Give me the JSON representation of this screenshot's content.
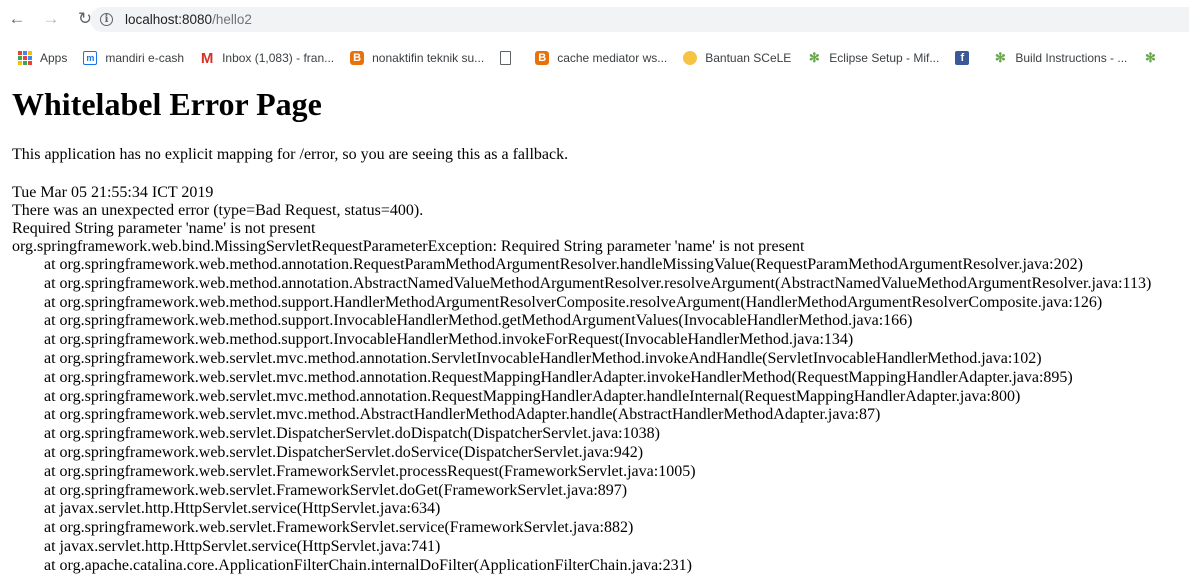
{
  "browser": {
    "url_host": "localhost:8080",
    "url_path": "/hello2",
    "bookmarks": [
      {
        "label": "Apps",
        "icon": "apps-grid-icon"
      },
      {
        "label": "mandiri e-cash",
        "icon": "mandiri-icon"
      },
      {
        "label": "Inbox (1,083) - fran...",
        "icon": "gmail-icon"
      },
      {
        "label": "nonaktifin teknik su...",
        "icon": "blogger-icon"
      },
      {
        "label": "",
        "icon": "document-icon"
      },
      {
        "label": "cache mediator ws...",
        "icon": "blogger-icon"
      },
      {
        "label": "Bantuan SCeLE",
        "icon": "scele-icon"
      },
      {
        "label": "Eclipse Setup - Mif...",
        "icon": "eclipse-icon"
      },
      {
        "label": "",
        "icon": "facebook-icon"
      },
      {
        "label": "Build Instructions - ...",
        "icon": "eclipse-icon"
      }
    ]
  },
  "page": {
    "title": "Whitelabel Error Page",
    "fallback": "This application has no explicit mapping for /error, so you are seeing this as a fallback.",
    "timestamp": "Tue Mar 05 21:55:34 ICT 2019",
    "error_line": "There was an unexpected error (type=Bad Request, status=400).",
    "message": "Required String parameter 'name' is not present",
    "exception": "org.springframework.web.bind.MissingServletRequestParameterException: Required String parameter 'name' is not present",
    "stack": [
      "at org.springframework.web.method.annotation.RequestParamMethodArgumentResolver.handleMissingValue(RequestParamMethodArgumentResolver.java:202)",
      "at org.springframework.web.method.annotation.AbstractNamedValueMethodArgumentResolver.resolveArgument(AbstractNamedValueMethodArgumentResolver.java:113)",
      "at org.springframework.web.method.support.HandlerMethodArgumentResolverComposite.resolveArgument(HandlerMethodArgumentResolverComposite.java:126)",
      "at org.springframework.web.method.support.InvocableHandlerMethod.getMethodArgumentValues(InvocableHandlerMethod.java:166)",
      "at org.springframework.web.method.support.InvocableHandlerMethod.invokeForRequest(InvocableHandlerMethod.java:134)",
      "at org.springframework.web.servlet.mvc.method.annotation.ServletInvocableHandlerMethod.invokeAndHandle(ServletInvocableHandlerMethod.java:102)",
      "at org.springframework.web.servlet.mvc.method.annotation.RequestMappingHandlerAdapter.invokeHandlerMethod(RequestMappingHandlerAdapter.java:895)",
      "at org.springframework.web.servlet.mvc.method.annotation.RequestMappingHandlerAdapter.handleInternal(RequestMappingHandlerAdapter.java:800)",
      "at org.springframework.web.servlet.mvc.method.AbstractHandlerMethodAdapter.handle(AbstractHandlerMethodAdapter.java:87)",
      "at org.springframework.web.servlet.DispatcherServlet.doDispatch(DispatcherServlet.java:1038)",
      "at org.springframework.web.servlet.DispatcherServlet.doService(DispatcherServlet.java:942)",
      "at org.springframework.web.servlet.FrameworkServlet.processRequest(FrameworkServlet.java:1005)",
      "at org.springframework.web.servlet.FrameworkServlet.doGet(FrameworkServlet.java:897)",
      "at javax.servlet.http.HttpServlet.service(HttpServlet.java:634)",
      "at org.springframework.web.servlet.FrameworkServlet.service(FrameworkServlet.java:882)",
      "at javax.servlet.http.HttpServlet.service(HttpServlet.java:741)",
      "at org.apache.catalina.core.ApplicationFilterChain.internalDoFilter(ApplicationFilterChain.java:231)"
    ]
  }
}
